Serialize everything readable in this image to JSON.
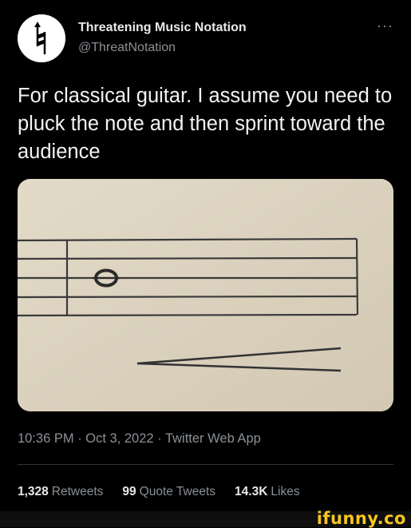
{
  "author": {
    "display_name": "Threatening Music Notation",
    "handle": "@ThreatNotation",
    "avatar_icon": "natural-sign-icon"
  },
  "more_label": "···",
  "tweet": {
    "text": "For classical guitar. I assume you need to pluck the note and then sprint toward the audience"
  },
  "meta": {
    "line": "10:36 PM · Oct 3, 2022 · Twitter Web App"
  },
  "stats": {
    "retweets_count": "1,328",
    "retweets_label": "Retweets",
    "quotes_count": "99",
    "quotes_label": "Quote Tweets",
    "likes_count": "14.3K",
    "likes_label": "Likes"
  },
  "watermark": "ifunny.co",
  "colors": {
    "background": "#000000",
    "primary_text": "#e7e9ea",
    "secondary_text": "#8b9096",
    "paper": "#ddd4c1",
    "watermark": "#f7c51e"
  }
}
